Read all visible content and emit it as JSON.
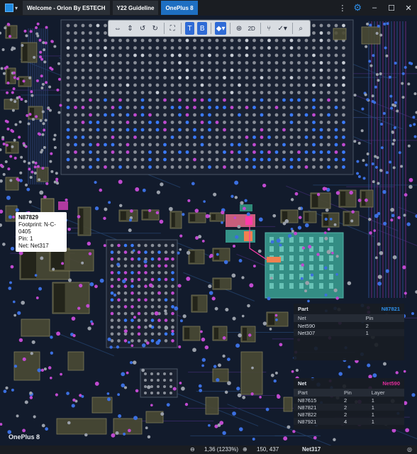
{
  "tabs": [
    {
      "label": "Welcome - Orion By ESTECH",
      "active": false
    },
    {
      "label": "Y22 Guideline",
      "active": false
    },
    {
      "label": "OnePlus 8",
      "active": true
    }
  ],
  "window_controls": {
    "kebab": "⋮",
    "minimize": "–",
    "maximize": "☐",
    "close": "✕"
  },
  "toolbar": {
    "buttons": [
      {
        "icon": "flip-horizontal-icon"
      },
      {
        "icon": "flip-vertical-icon"
      },
      {
        "icon": "rotate-left-icon"
      },
      {
        "icon": "rotate-right-icon"
      },
      {
        "icon": "fit-view-icon"
      },
      {
        "icon": "top-side-icon",
        "label": "T"
      },
      {
        "icon": "bottom-side-icon",
        "label": "B"
      },
      {
        "icon": "layers-icon"
      },
      {
        "icon": "3d-view-icon"
      },
      {
        "icon": "2d-view-icon",
        "label": "2D"
      },
      {
        "icon": "net-trace-icon"
      },
      {
        "icon": "measure-icon"
      },
      {
        "icon": "search-icon"
      }
    ]
  },
  "tooltip": {
    "title": "N87829",
    "footprint": "Footprint: N-C-0405",
    "pin": "Pin: 1",
    "net": "Net: Net317"
  },
  "part_panel": {
    "title": "Part",
    "id": "N87821",
    "columns": [
      "Net",
      "Pin"
    ],
    "rows": [
      {
        "net": "Net590",
        "pin": "2"
      },
      {
        "net": "Net307",
        "pin": "1"
      }
    ]
  },
  "net_panel": {
    "title": "Net",
    "id": "Net590",
    "columns": [
      "Part",
      "Pin",
      "Layer"
    ],
    "rows": [
      {
        "part": "N87615",
        "pin": "2",
        "layer": "1"
      },
      {
        "part": "N87821",
        "pin": "2",
        "layer": "1"
      },
      {
        "part": "N87822",
        "pin": "2",
        "layer": "1"
      },
      {
        "part": "N87921",
        "pin": "4",
        "layer": "1"
      }
    ]
  },
  "board_name": "OnePlus 8",
  "statusbar": {
    "zoom": "1,36 (1233%)",
    "coords": "150, 437",
    "net": "Net317"
  },
  "colors": {
    "accent": "#1e6fc2",
    "part_id": "#2d8fea",
    "net_id": "#e02c9a",
    "highlight_part": "#e86a8a",
    "highlight_pad": "#f08050",
    "chip_teal": "#3aa294"
  }
}
